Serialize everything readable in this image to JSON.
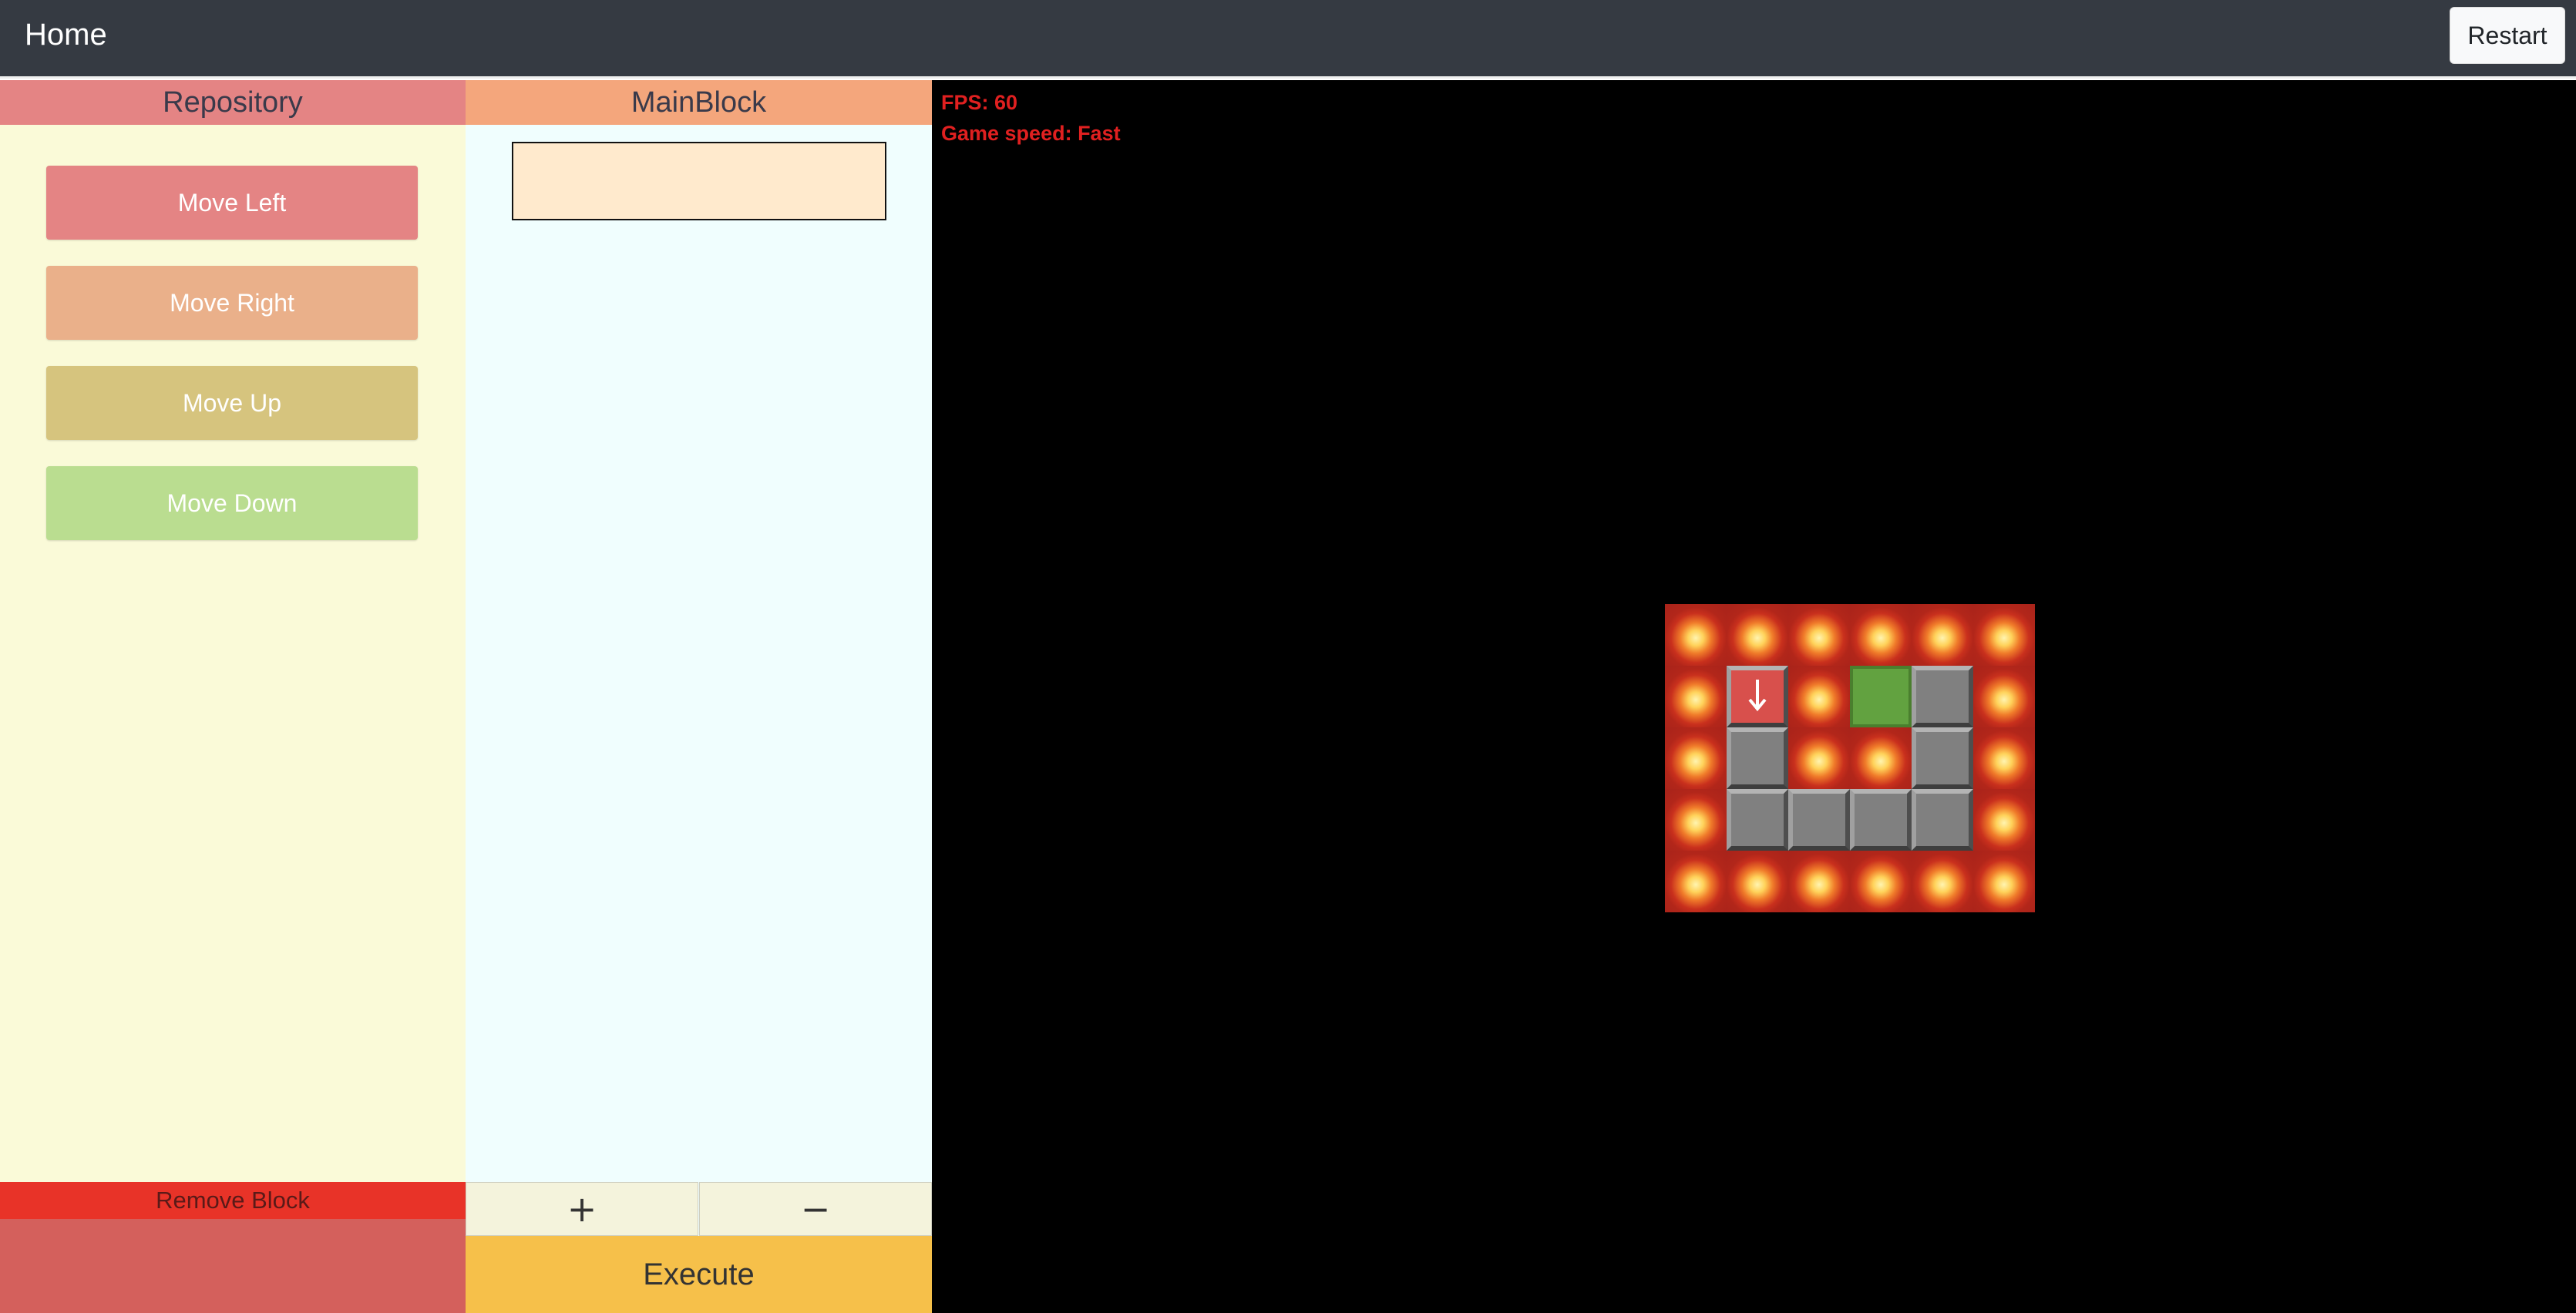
{
  "topbar": {
    "home_label": "Home",
    "restart_label": "Restart"
  },
  "repository": {
    "title": "Repository",
    "commands": [
      {
        "label": "Move Left",
        "color": "#e48484"
      },
      {
        "label": "Move Right",
        "color": "#eab08a"
      },
      {
        "label": "Move Up",
        "color": "#d6c47e"
      },
      {
        "label": "Move Down",
        "color": "#badd90"
      }
    ],
    "remove_label": "Remove Block"
  },
  "main_block": {
    "title": "MainBlock",
    "plus_label": "+",
    "minus_label": "−",
    "execute_label": "Execute"
  },
  "game": {
    "fps_text": "FPS: 60",
    "speed_text": "Game speed: Fast",
    "player_direction_icon": "arrow-down-icon",
    "grid": [
      [
        "lava",
        "lava",
        "lava",
        "lava",
        "lava",
        "lava"
      ],
      [
        "lava",
        "player",
        "lava",
        "goal",
        "wall",
        "lava"
      ],
      [
        "lava",
        "wall",
        "lava",
        "lava",
        "wall",
        "lava"
      ],
      [
        "lava",
        "wall",
        "wall",
        "wall",
        "wall",
        "lava"
      ],
      [
        "lava",
        "lava",
        "lava",
        "lava",
        "lava",
        "lava"
      ]
    ]
  }
}
